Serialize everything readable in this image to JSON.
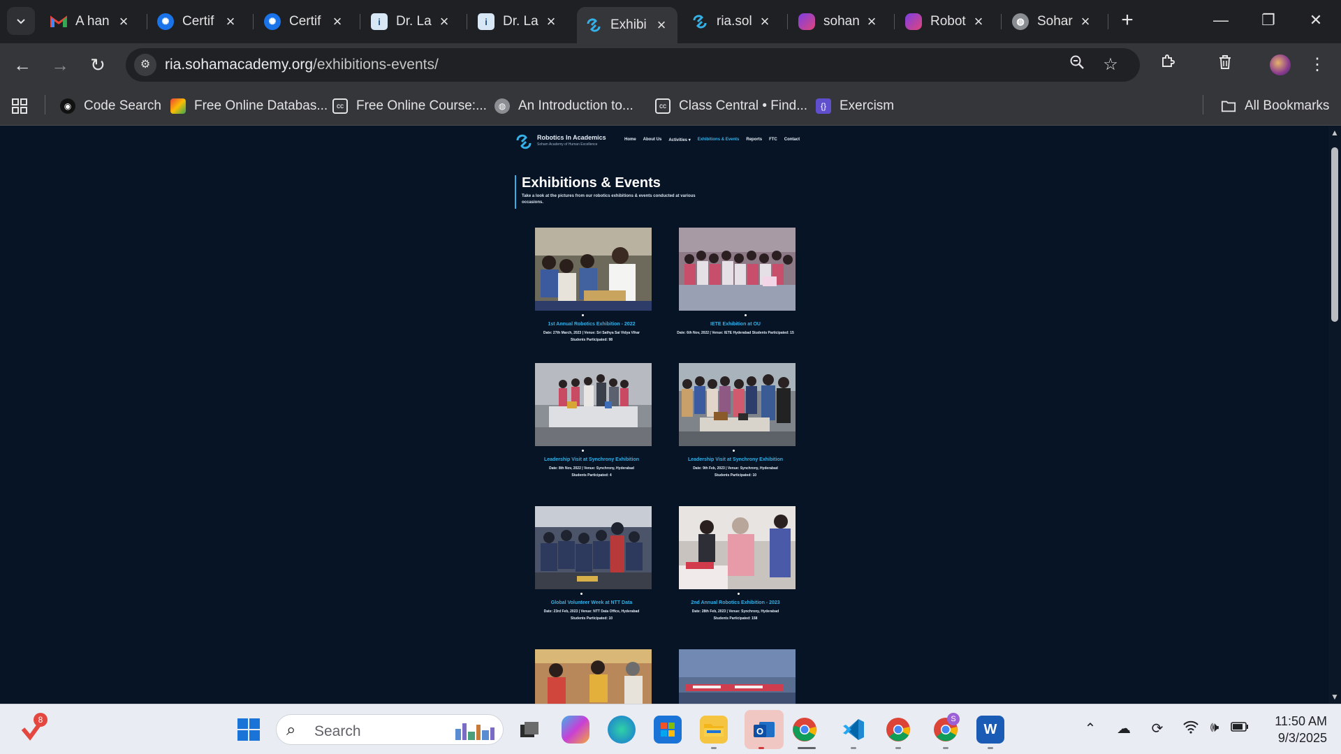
{
  "browser": {
    "tabs": [
      {
        "title": "A han",
        "icon": "gmail-icon",
        "color": "#ea4335"
      },
      {
        "title": "Certif",
        "icon": "gear-icon",
        "color": "#1a73e8"
      },
      {
        "title": "Certif",
        "icon": "gear-icon",
        "color": "#1a73e8"
      },
      {
        "title": "Dr. La",
        "icon": "page-icon",
        "color": "#d7e7f6"
      },
      {
        "title": "Dr. La",
        "icon": "page-icon",
        "color": "#d7e7f6"
      },
      {
        "title": "Exhibi",
        "icon": "robotics-logo-icon",
        "color": "#35b1e8"
      },
      {
        "title": "ria.sol",
        "icon": "robotics-logo-icon",
        "color": "#35b1e8"
      },
      {
        "title": "sohan",
        "icon": "poe-icon",
        "color": "#d14b8f"
      },
      {
        "title": "Robot",
        "icon": "poe-icon",
        "color": "#d14b8f"
      },
      {
        "title": "Sohar",
        "icon": "globe-icon",
        "color": "#8a8d91"
      }
    ],
    "url_host": "ria.sohamacademy.org",
    "url_path": "/exhibitions-events/",
    "bookmarks": [
      {
        "label": "Code Search",
        "icon": "code-search-icon"
      },
      {
        "label": "Free Online Databas...",
        "icon": "database-icon"
      },
      {
        "label": "Free Online Course:...",
        "icon": "class-central-icon"
      },
      {
        "label": "An Introduction to...",
        "icon": "globe-icon"
      },
      {
        "label": "Class Central • Find...",
        "icon": "class-central-icon"
      },
      {
        "label": "Exercism",
        "icon": "exercism-icon"
      }
    ],
    "all_bookmarks": "All Bookmarks"
  },
  "site": {
    "logo_title": "Robotics In Academics",
    "logo_subtitle": "Soham Academy of Human Excellence",
    "menu": [
      "Home",
      "About Us",
      "Activities ▾",
      "Exhibitions & Events",
      "Reports",
      "FTC",
      "Contact"
    ],
    "active_menu": "Exhibitions & Events",
    "heading": "Exhibitions & Events",
    "intro": "Take a look at the pictures from our robotics exhibitions & events  conducted at various occasions.",
    "events": [
      {
        "title": "1st Annual Robotics Exhibition - 2022",
        "date": "Date: 27th March, 2023 | Venue: Sri Sathya Sai Vidya Vihar",
        "students": "Students Participated: 98"
      },
      {
        "title": "IETE Exhibition at OU",
        "date": "Date: 6th Nov, 2022 | Venue: IETE Hyderabad  Students Participated: 15",
        "students": ""
      },
      {
        "title": "Leadership Visit at Synchrony Exhibition",
        "date": "Date: 8th Nov, 2022 | Venue: Synchrony, Hyderabad",
        "students": "Students Participated: 4"
      },
      {
        "title": "Leadership Visit at Synchrony Exhibition",
        "date": "Date: 9th Feb, 2023 | Venue: Synchrony, Hyderabad",
        "students": "Students Participated: 10"
      },
      {
        "title": "Global Volunteer Week at NTT Data",
        "date": "Date: 23rd Feb, 2023 | Venue: NTT Data Office, Hyderabad",
        "students": "Students Participated: 10"
      },
      {
        "title": "2nd Annual Robotics Exhibition - 2023",
        "date": "Date: 28th Feb, 2023 | Venue: Synchrony, Hyderabad",
        "students": "Students Participated: 158"
      }
    ]
  },
  "taskbar": {
    "search_placeholder": "Search",
    "notification_count": "8",
    "time": "11:50 AM",
    "date": "9/3/2025",
    "chrome_profile_badge": "S"
  },
  "colors": {
    "page_bg": "#071425",
    "accent": "#35b1e8",
    "chrome_dark": "#35363a"
  }
}
